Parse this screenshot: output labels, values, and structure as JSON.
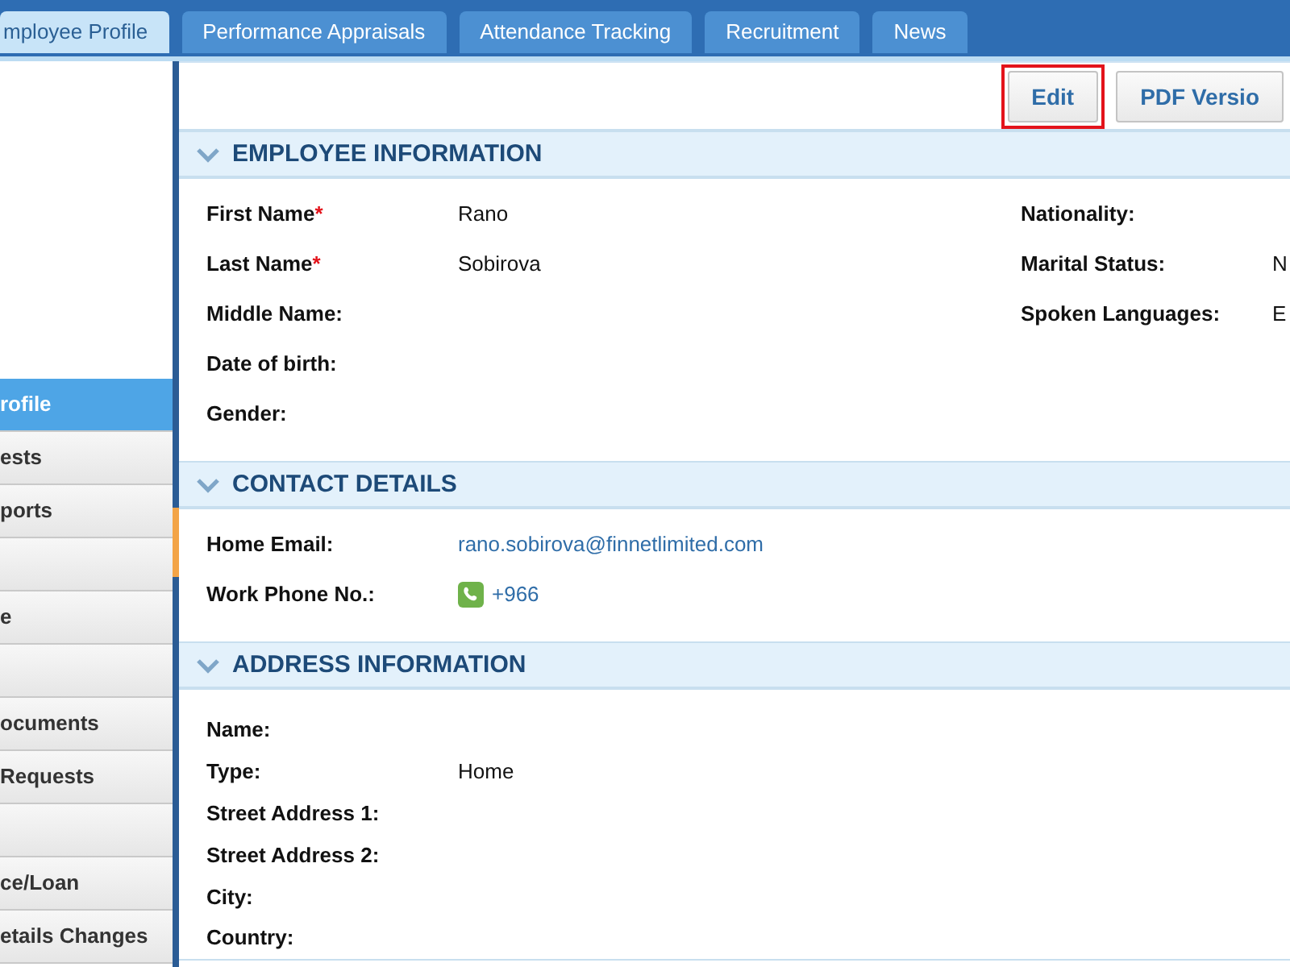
{
  "tabs": [
    {
      "label": "mployee Profile",
      "selected": true
    },
    {
      "label": "Performance Appraisals",
      "selected": false
    },
    {
      "label": "Attendance Tracking",
      "selected": false
    },
    {
      "label": "Recruitment",
      "selected": false
    },
    {
      "label": "News",
      "selected": false
    }
  ],
  "sidebar": {
    "items": [
      {
        "label": "rofile",
        "selected": true
      },
      {
        "label": "ests",
        "selected": false
      },
      {
        "label": "ports",
        "selected": false
      },
      {
        "selected": false
      },
      {
        "label": "e",
        "selected": false
      },
      {
        "selected": false
      },
      {
        "label": "ocuments",
        "selected": false
      },
      {
        "label": "Requests",
        "selected": false
      },
      {
        "selected": false
      },
      {
        "label": "ce/Loan",
        "selected": false
      },
      {
        "label": "etails Changes",
        "selected": false
      }
    ]
  },
  "toolbar": {
    "buttons": [
      {
        "label": "Edit",
        "highlighted": true
      },
      {
        "label": "PDF Versio",
        "highlighted": false
      }
    ]
  },
  "sections": [
    {
      "title": "EMPLOYEE INFORMATION",
      "expanded": true,
      "rows": [
        {
          "left": {
            "label": "First Name",
            "marker": "*",
            "value": "Rano"
          },
          "right": {
            "label": "Nationality:"
          }
        },
        {
          "left": {
            "label": "Last Name",
            "marker": "*",
            "value": "Sobirova"
          },
          "right": {
            "label": "Marital Status:",
            "value": "N"
          }
        },
        {
          "left": {
            "label": "Middle Name:"
          },
          "right": {
            "label": "Spoken Languages:",
            "value": "E"
          }
        },
        {
          "left": {
            "label": "Date of birth:"
          }
        },
        {
          "left": {
            "label": "Gender:"
          }
        }
      ]
    },
    {
      "title": "CONTACT DETAILS",
      "expanded": true,
      "rows": [
        {
          "left": {
            "label": "Home Email:",
            "value": "rano.sobirova@finnetlimited.com",
            "kind": "email"
          }
        },
        {
          "left": {
            "label": "Work Phone No.:",
            "value": "+966",
            "kind": "phone"
          }
        }
      ]
    },
    {
      "title": "ADDRESS INFORMATION",
      "expanded": true,
      "rows": [
        {
          "left": {
            "label": "Name:"
          }
        },
        {
          "left": {
            "label": "Type:",
            "value": "Home"
          }
        },
        {
          "left": {
            "label": "Street Address 1:"
          }
        },
        {
          "left": {
            "label": "Street Address 2:"
          }
        },
        {
          "left": {
            "label": "City:"
          }
        },
        {
          "left": {
            "label": "Country:"
          }
        }
      ]
    }
  ]
}
